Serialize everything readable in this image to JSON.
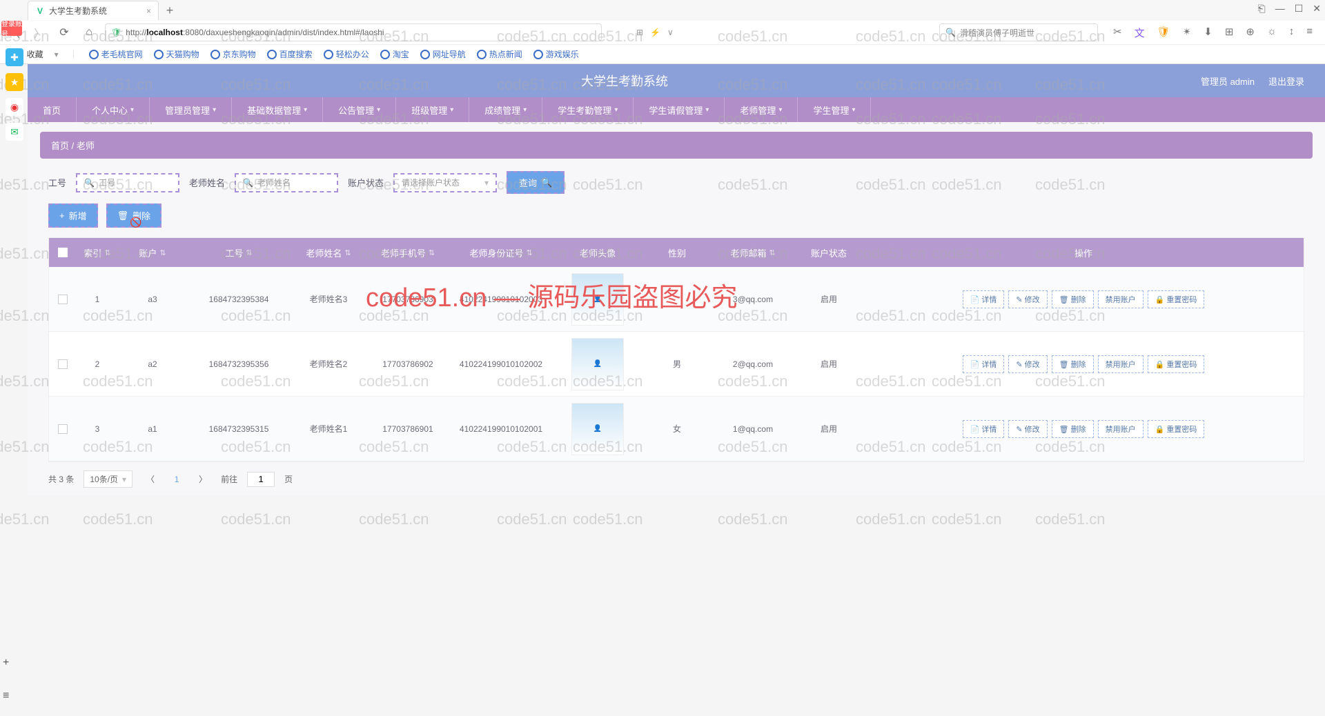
{
  "browser": {
    "tab_title": "大学生考勤系统",
    "url_prefix": "http://",
    "url_host": "localhost",
    "url_rest": ":8080/daxueshengkaoqin/admin/dist/index.html#/laoshi",
    "search_placeholder": "滑稽演员傅子明逝世",
    "fav_label": "收藏"
  },
  "bookmarks": [
    "老毛桃官网",
    "天猫购物",
    "京东购物",
    "百度搜索",
    "轻松办公",
    "淘宝",
    "网址导航",
    "热点新闻",
    "游戏娱乐"
  ],
  "float_badge": "登录账号",
  "app": {
    "title": "大学生考勤系统",
    "user": "管理员 admin",
    "logout": "退出登录"
  },
  "menu": [
    "首页",
    "个人中心",
    "管理员管理",
    "基础数据管理",
    "公告管理",
    "班级管理",
    "成绩管理",
    "学生考勤管理",
    "学生请假管理",
    "老师管理",
    "学生管理"
  ],
  "crumb": {
    "home": "首页",
    "sep": "/",
    "current": "老师"
  },
  "filters": {
    "emp_label": "工号",
    "emp_placeholder": "工号",
    "name_label": "老师姓名",
    "name_placeholder": "老师姓名",
    "status_label": "账户状态",
    "status_placeholder": "请选择账户状态",
    "query": "查询"
  },
  "buttons": {
    "add": "新增",
    "delete": "删除"
  },
  "columns": {
    "idx": "索引",
    "acc": "账户",
    "emp": "工号",
    "name": "老师姓名",
    "phone": "老师手机号",
    "id": "老师身份证号",
    "avatar": "老师头像",
    "sex": "性别",
    "email": "老师邮箱",
    "status": "账户状态",
    "ops": "操作"
  },
  "ops": {
    "detail": "详情",
    "edit": "修改",
    "del": "删除",
    "disable": "禁用账户",
    "reset": "重置密码"
  },
  "rows": [
    {
      "idx": "1",
      "acc": "a3",
      "emp": "1684732395384",
      "name": "老师姓名3",
      "phone": "17703786903",
      "id": "410224199010102003",
      "sex": "",
      "email": "3@qq.com",
      "status": "启用"
    },
    {
      "idx": "2",
      "acc": "a2",
      "emp": "1684732395356",
      "name": "老师姓名2",
      "phone": "17703786902",
      "id": "410224199010102002",
      "sex": "男",
      "email": "2@qq.com",
      "status": "启用"
    },
    {
      "idx": "3",
      "acc": "a1",
      "emp": "1684732395315",
      "name": "老师姓名1",
      "phone": "17703786901",
      "id": "410224199010102001",
      "sex": "女",
      "email": "1@qq.com",
      "status": "启用"
    }
  ],
  "pager": {
    "total": "共 3 条",
    "per_page": "10条/页",
    "current": "1",
    "goto": "前往",
    "goto_val": "1",
    "page_unit": "页"
  },
  "watermark_text": "code51.cn",
  "big_watermark": "code51.cn — 源码乐园盗图必究"
}
